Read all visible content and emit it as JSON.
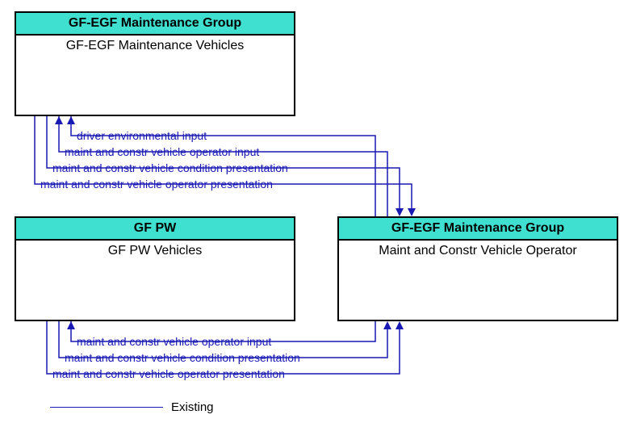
{
  "nodes": {
    "top": {
      "header": "GF-EGF Maintenance Group",
      "body": "GF-EGF Maintenance Vehicles"
    },
    "left": {
      "header": "GF PW",
      "body": "GF PW Vehicles"
    },
    "right": {
      "header": "GF-EGF Maintenance Group",
      "body": "Maint and Constr Vehicle Operator"
    }
  },
  "flows_top": {
    "f1": "driver environmental input",
    "f2": "maint and constr vehicle operator input",
    "f3": "maint and constr vehicle condition presentation",
    "f4": "maint and constr vehicle operator presentation"
  },
  "flows_bottom": {
    "f1": "maint and constr vehicle operator input",
    "f2": "maint and constr vehicle condition presentation",
    "f3": "maint and constr vehicle operator presentation"
  },
  "legend": {
    "existing": "Existing"
  }
}
